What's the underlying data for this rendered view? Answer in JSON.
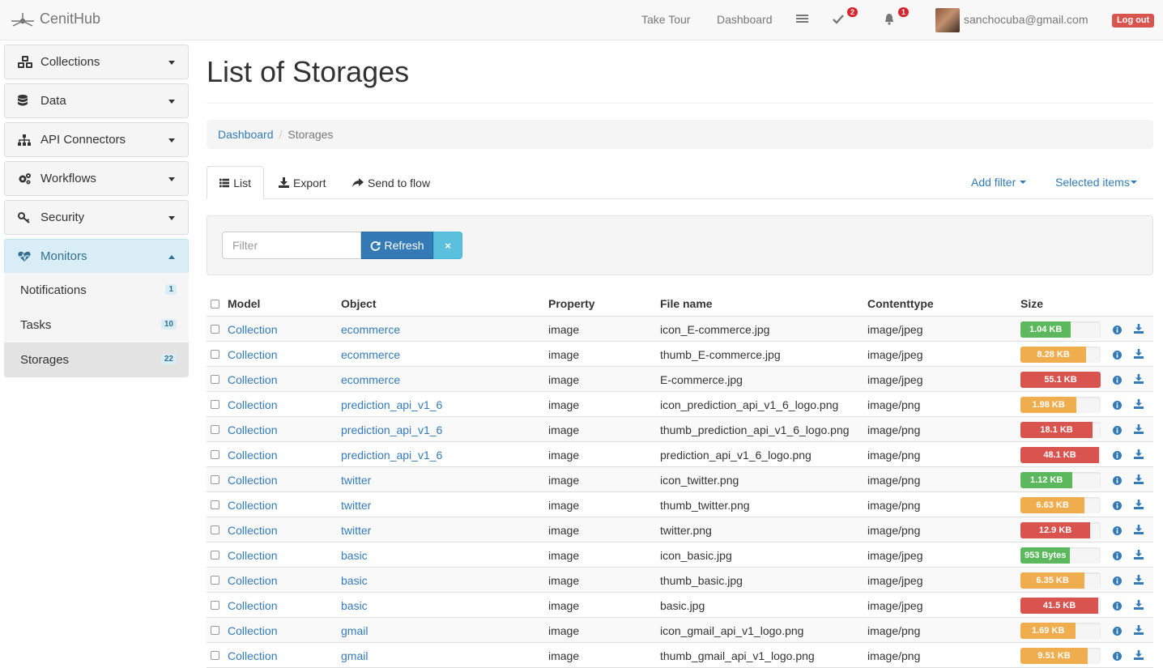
{
  "navbar": {
    "brand": "CenitHub",
    "take_tour": "Take Tour",
    "dashboard": "Dashboard",
    "tasks_badge": "2",
    "notifications_badge": "1",
    "user_email": "sanchocuba@gmail.com",
    "logout": "Log out"
  },
  "sidebar": {
    "items": [
      {
        "label": "Collections"
      },
      {
        "label": "Data"
      },
      {
        "label": "API Connectors"
      },
      {
        "label": "Workflows"
      },
      {
        "label": "Security"
      },
      {
        "label": "Monitors"
      }
    ],
    "monitors_sub": [
      {
        "label": "Notifications",
        "count": "1"
      },
      {
        "label": "Tasks",
        "count": "10"
      },
      {
        "label": "Storages",
        "count": "22"
      }
    ]
  },
  "page": {
    "title": "List of Storages",
    "breadcrumb": {
      "home": "Dashboard",
      "current": "Storages"
    }
  },
  "tabs": {
    "list": "List",
    "export": "Export",
    "send_to_flow": "Send to flow"
  },
  "actions": {
    "add_filter": "Add filter",
    "selected_items": "Selected items"
  },
  "filter": {
    "placeholder": "Filter",
    "refresh": "Refresh",
    "clear": "×"
  },
  "table": {
    "headers": {
      "model": "Model",
      "object": "Object",
      "property": "Property",
      "file_name": "File name",
      "content_type": "Contenttype",
      "size": "Size"
    },
    "rows": [
      {
        "model": "Collection",
        "object": "ecommerce",
        "property": "image",
        "file_name": "icon_E-commerce.jpg",
        "content_type": "image/jpeg",
        "size": "1.04 KB",
        "fill": 0.63,
        "color": "#5cb85c"
      },
      {
        "model": "Collection",
        "object": "ecommerce",
        "property": "image",
        "file_name": "thumb_E-commerce.jpg",
        "content_type": "image/jpeg",
        "size": "8.28 KB",
        "fill": 0.82,
        "color": "#f0ad4e"
      },
      {
        "model": "Collection",
        "object": "ecommerce",
        "property": "image",
        "file_name": "E-commerce.jpg",
        "content_type": "image/jpeg",
        "size": "55.1 KB",
        "fill": 1.0,
        "color": "#d9534f"
      },
      {
        "model": "Collection",
        "object": "prediction_api_v1_6",
        "property": "image",
        "file_name": "icon_prediction_api_v1_6_logo.png",
        "content_type": "image/png",
        "size": "1.98 KB",
        "fill": 0.7,
        "color": "#f0ad4e"
      },
      {
        "model": "Collection",
        "object": "prediction_api_v1_6",
        "property": "image",
        "file_name": "thumb_prediction_api_v1_6_logo.png",
        "content_type": "image/png",
        "size": "18.1 KB",
        "fill": 0.9,
        "color": "#d9534f"
      },
      {
        "model": "Collection",
        "object": "prediction_api_v1_6",
        "property": "image",
        "file_name": "prediction_api_v1_6_logo.png",
        "content_type": "image/png",
        "size": "48.1 KB",
        "fill": 0.98,
        "color": "#d9534f"
      },
      {
        "model": "Collection",
        "object": "twitter",
        "property": "image",
        "file_name": "icon_twitter.png",
        "content_type": "image/png",
        "size": "1.12 KB",
        "fill": 0.65,
        "color": "#5cb85c"
      },
      {
        "model": "Collection",
        "object": "twitter",
        "property": "image",
        "file_name": "thumb_twitter.png",
        "content_type": "image/png",
        "size": "6.63 KB",
        "fill": 0.8,
        "color": "#f0ad4e"
      },
      {
        "model": "Collection",
        "object": "twitter",
        "property": "image",
        "file_name": "twitter.png",
        "content_type": "image/png",
        "size": "12.9 KB",
        "fill": 0.87,
        "color": "#d9534f"
      },
      {
        "model": "Collection",
        "object": "basic",
        "property": "image",
        "file_name": "icon_basic.jpg",
        "content_type": "image/jpeg",
        "size": "953 Bytes",
        "fill": 0.62,
        "color": "#5cb85c"
      },
      {
        "model": "Collection",
        "object": "basic",
        "property": "image",
        "file_name": "thumb_basic.jpg",
        "content_type": "image/jpeg",
        "size": "6.35 KB",
        "fill": 0.8,
        "color": "#f0ad4e"
      },
      {
        "model": "Collection",
        "object": "basic",
        "property": "image",
        "file_name": "basic.jpg",
        "content_type": "image/jpeg",
        "size": "41.5 KB",
        "fill": 0.97,
        "color": "#d9534f"
      },
      {
        "model": "Collection",
        "object": "gmail",
        "property": "image",
        "file_name": "icon_gmail_api_v1_logo.png",
        "content_type": "image/png",
        "size": "1.69 KB",
        "fill": 0.69,
        "color": "#f0ad4e"
      },
      {
        "model": "Collection",
        "object": "gmail",
        "property": "image",
        "file_name": "thumb_gmail_api_v1_logo.png",
        "content_type": "image/png",
        "size": "9.51 KB",
        "fill": 0.84,
        "color": "#f0ad4e"
      }
    ]
  }
}
